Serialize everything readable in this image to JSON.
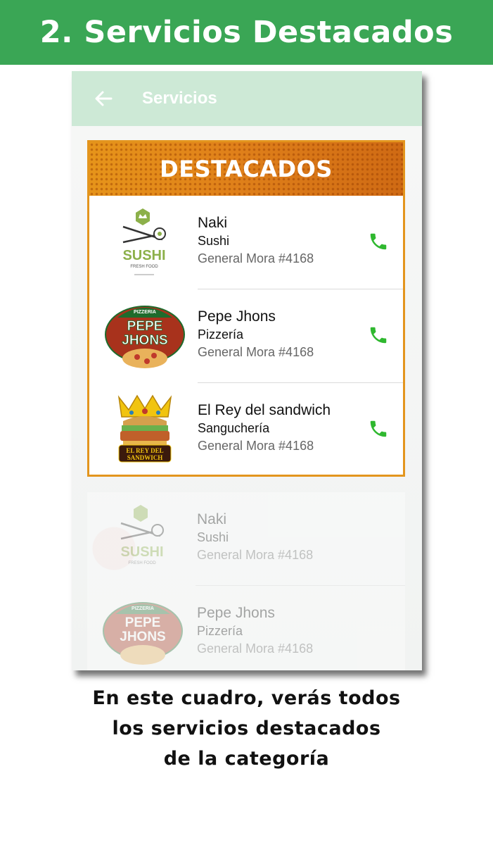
{
  "banner": {
    "title": "2. Servicios Destacados"
  },
  "appbar": {
    "title": "Servicios",
    "back_icon": "arrow-left-icon"
  },
  "featured": {
    "header": "DESTACADOS",
    "items": [
      {
        "name": "Naki",
        "category": "Sushi",
        "address": "General Mora #4168",
        "logo_text": "SUSHI",
        "logo_sub": "FRESH FOOD"
      },
      {
        "name": "Pepe Jhons",
        "category": "Pizzería",
        "address": "General Mora #4168",
        "logo_text_1": "PEPE",
        "logo_text_2": "JHONS",
        "logo_top": "PIZZERIA"
      },
      {
        "name": "El Rey del sandwich",
        "category": "Sanguchería",
        "address": "General Mora #4168",
        "logo_text_1": "EL REY DEL",
        "logo_text_2": "SANDWICH"
      }
    ]
  },
  "list": {
    "items": [
      {
        "name": "Naki",
        "category": "Sushi",
        "address": "General Mora #4168"
      },
      {
        "name": "Pepe Jhons",
        "category": "Pizzería",
        "address": "General Mora #4168"
      }
    ]
  },
  "caption": {
    "line1": "En este cuadro, verás todos",
    "line2": "los servicios destacados",
    "line3": "de la categoría"
  },
  "colors": {
    "banner": "#3aa655",
    "appbar": "#cde9d6",
    "accent": "#e3951e",
    "call": "#2fb82f"
  }
}
